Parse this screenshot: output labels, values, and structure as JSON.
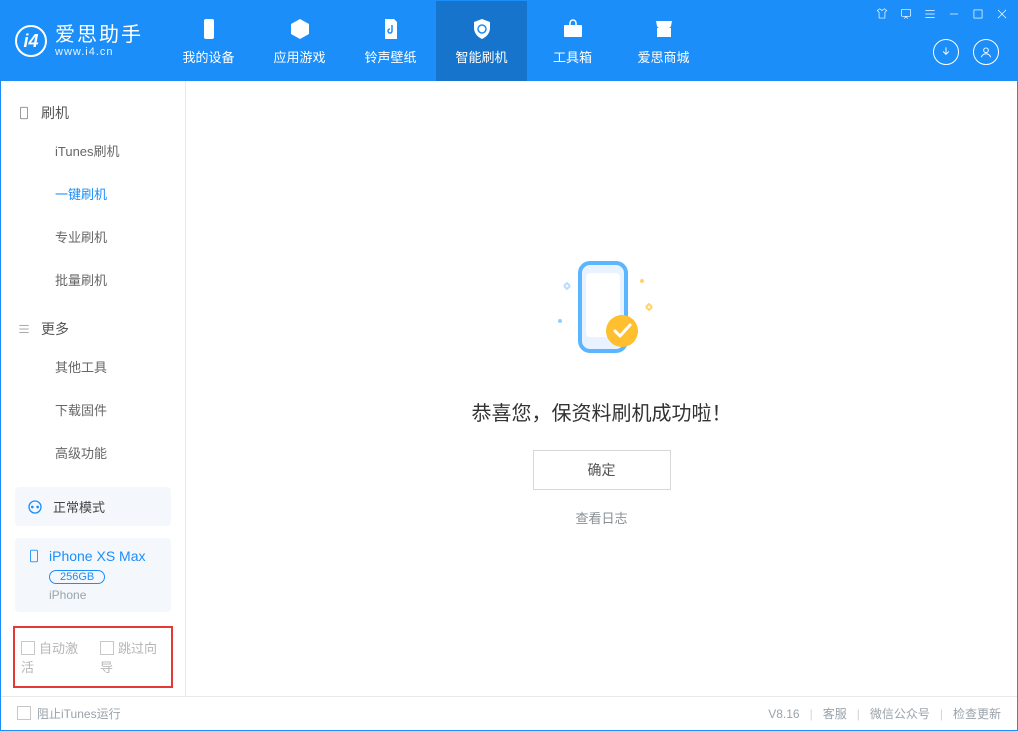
{
  "app": {
    "name_cn": "爱思助手",
    "name_en": "www.i4.cn"
  },
  "nav": {
    "device": "我的设备",
    "apps": "应用游戏",
    "media": "铃声壁纸",
    "flash": "智能刷机",
    "tools": "工具箱",
    "store": "爱思商城"
  },
  "sidebar": {
    "group_flash": "刷机",
    "items_flash": {
      "itunes": "iTunes刷机",
      "onekey": "一键刷机",
      "pro": "专业刷机",
      "batch": "批量刷机"
    },
    "group_more": "更多",
    "items_more": {
      "other": "其他工具",
      "firmware": "下载固件",
      "advanced": "高级功能"
    },
    "mode": "正常模式",
    "device": {
      "name": "iPhone XS Max",
      "capacity": "256GB",
      "type": "iPhone"
    },
    "checks": {
      "auto_activate": "自动激活",
      "skip_guide": "跳过向导"
    }
  },
  "main": {
    "success_title": "恭喜您，保资料刷机成功啦！",
    "ok": "确定",
    "view_log": "查看日志"
  },
  "footer": {
    "block_itunes": "阻止iTunes运行",
    "version": "V8.16",
    "support": "客服",
    "wechat": "微信公众号",
    "update": "检查更新"
  }
}
